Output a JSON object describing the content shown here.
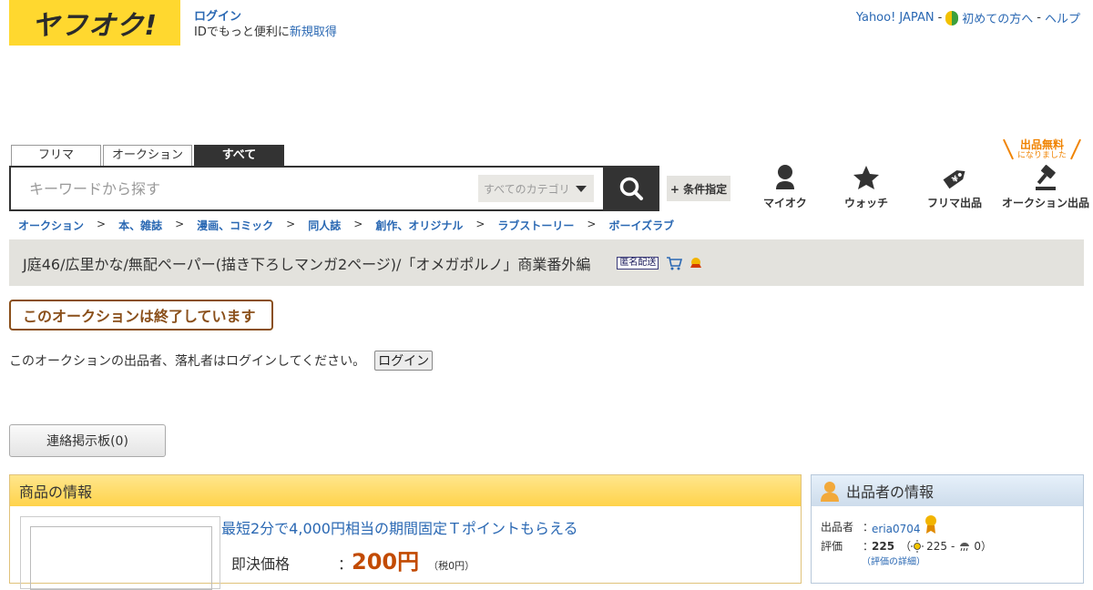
{
  "header": {
    "logo_text": "ヤフオク!",
    "login_label": "ログイン",
    "id_text": "IDでもっと便利に",
    "signup_label": "新規取得",
    "topnav": {
      "yahoo_japan": "Yahoo! JAPAN",
      "first_time": "初めての方へ",
      "help": "ヘルプ",
      "sep": "-"
    }
  },
  "search": {
    "tabs": [
      "フリマ",
      "オークション",
      "すべて"
    ],
    "active_tab": "すべて",
    "placeholder": "キーワードから探す",
    "category": "すべてのカテゴリ",
    "condition_button": "+ 条件指定"
  },
  "free_badge": {
    "line1": "出品無料",
    "line2": "になりました"
  },
  "quick_nav": [
    {
      "label": "マイオク",
      "icon": "person-icon"
    },
    {
      "label": "ウォッチ",
      "icon": "star-icon"
    },
    {
      "label": "フリマ出品",
      "icon": "price-tag-icon"
    },
    {
      "label": "オークション出品",
      "icon": "gavel-icon"
    }
  ],
  "breadcrumb": [
    "オークション",
    "本、雑誌",
    "漫画、コミック",
    "同人誌",
    "創作、オリジナル",
    "ラブストーリー",
    "ボーイズラブ"
  ],
  "breadcrumb_sep": ">",
  "item": {
    "title": "J庭46/広里かな/無配ペーパー(描き下ろしマンガ2ページ)/「オメガポルノ」商業番外編",
    "tokumei_badge": "匿名配送",
    "ended_text": "このオークションは終了しています",
    "login_notice": "このオークションの出品者、落札者はログインしてください。",
    "login_button": "ログイン",
    "board_button": "連絡掲示板(0)"
  },
  "item_panel": {
    "heading": "商品の情報",
    "tpoint_link": "最短2分で4,000円相当の期間固定Ｔポイントもらえる",
    "price_label": "即決価格",
    "price_colon": "：",
    "price": "200円",
    "tax": "（税0円）"
  },
  "seller_panel": {
    "heading": "出品者の情報",
    "seller_label": "出品者",
    "seller_id": "eria0704",
    "rating_label": "評価",
    "rating_total": "225",
    "rating_good": "225",
    "rating_bad": "0",
    "rating_detail": "（評価の詳細）",
    "colon": "：",
    "paren_open": "（",
    "paren_close": "）",
    "dash": "-"
  },
  "colors": {
    "logo_yellow": "#ffd82f",
    "link": "#2a68b3",
    "price": "#c24a00",
    "ended": "#8a4f1a",
    "badge_orange": "#f08300"
  }
}
